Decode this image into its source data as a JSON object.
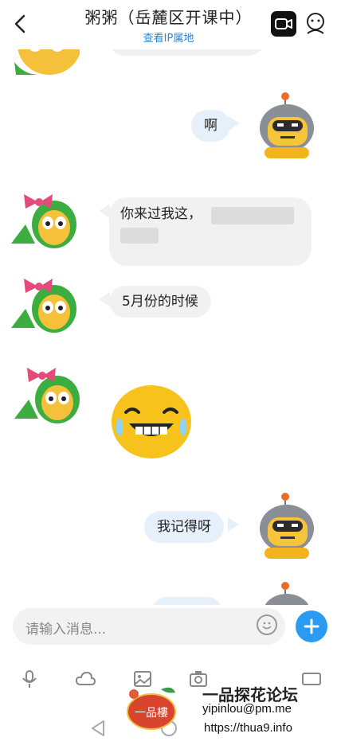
{
  "header": {
    "title": "粥粥（岳麓区开课中）",
    "subtitle": "查看IP属地"
  },
  "messages": {
    "m1": "啊",
    "m2_line1": "你来过我这，",
    "m3": "5月份的时候",
    "m5": "我记得呀"
  },
  "composer": {
    "placeholder": "请输入消息..."
  },
  "watermark": {
    "brand": "一品探花论坛",
    "email": "yipinlou@pm.me",
    "url": "https://thua9.info",
    "logo_text": "一品樓"
  },
  "colors": {
    "accent": "#2b9af3",
    "link": "#2b84d8",
    "outgoing_bubble": "#e6f0fa",
    "incoming_bubble": "#f1f1f1"
  },
  "icons": [
    "back-icon",
    "video-call-icon",
    "profile-icon",
    "emoji-icon",
    "plus-icon",
    "mic-icon",
    "cloud-icon",
    "image-icon",
    "camera-icon",
    "gif-icon",
    "nav-back-icon",
    "nav-home-icon"
  ]
}
